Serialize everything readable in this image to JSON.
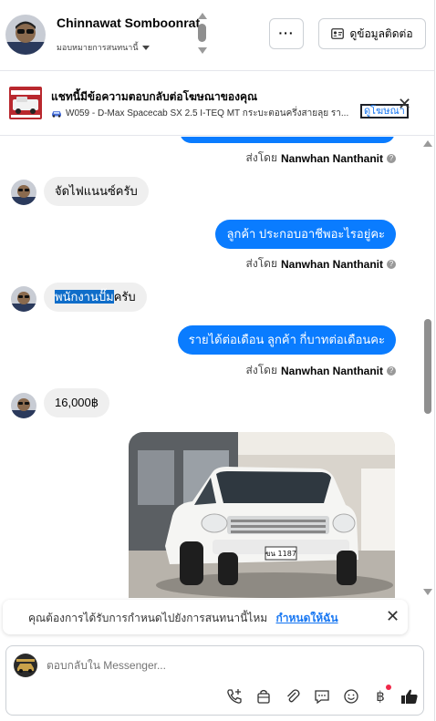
{
  "header": {
    "contact_name": "Chinnawat Somboonrat",
    "assign_label": "มอบหมายการสนทนานี้",
    "more_label": "···",
    "contact_info_label": "ดูข้อมูลติดต่อ"
  },
  "ad_banner": {
    "title": "แชทนี้มีข้อความตอบกลับต่อโฆษณาของคุณ",
    "subtitle": "W059 - D-Max Spacecab SX 2.5 I-TEQ MT กระบะตอนครึ่งสายลุย รา...",
    "view_ad_label": "ดูโฆษณา"
  },
  "messages": [
    {
      "direction": "out",
      "text": "",
      "sent_by_prefix": "ส่งโดย",
      "sent_by_name": "Nanwhan Nanthanit"
    },
    {
      "direction": "in",
      "text": "จัดไฟแนนซ์ครับ"
    },
    {
      "direction": "out",
      "text": "ลูกค้า ประกอบอาชีพอะไรอยู่คะ",
      "sent_by_prefix": "ส่งโดย",
      "sent_by_name": "Nanwhan Nanthanit"
    },
    {
      "direction": "in",
      "text_highlight": "พนักงานปั๊ม",
      "text": "ครับ"
    },
    {
      "direction": "out",
      "text": "รายได้ต่อเดือน  ลูกค้า กี่บาทต่อเดือนคะ",
      "sent_by_prefix": "ส่งโดย",
      "sent_by_name": "Nanwhan Nanthanit"
    },
    {
      "direction": "in",
      "text": "16,000฿"
    },
    {
      "direction": "out",
      "type": "image",
      "plate": "ขน 1187"
    }
  ],
  "notice": {
    "text": "คุณต้องการได้รับการกำหนดไปยังการสนทนานี้ไหม",
    "link": "กำหนดให้ฉัน"
  },
  "composer": {
    "placeholder": "ตอบกลับใน Messenger..."
  },
  "icons": [
    "call-add-icon",
    "bag-icon",
    "attach-icon",
    "saved-reply-icon",
    "emoji-icon",
    "baht-icon",
    "like-icon"
  ],
  "colors": {
    "accent": "#0a7cff",
    "link": "#1877f2",
    "in_bubble": "#efefef"
  }
}
